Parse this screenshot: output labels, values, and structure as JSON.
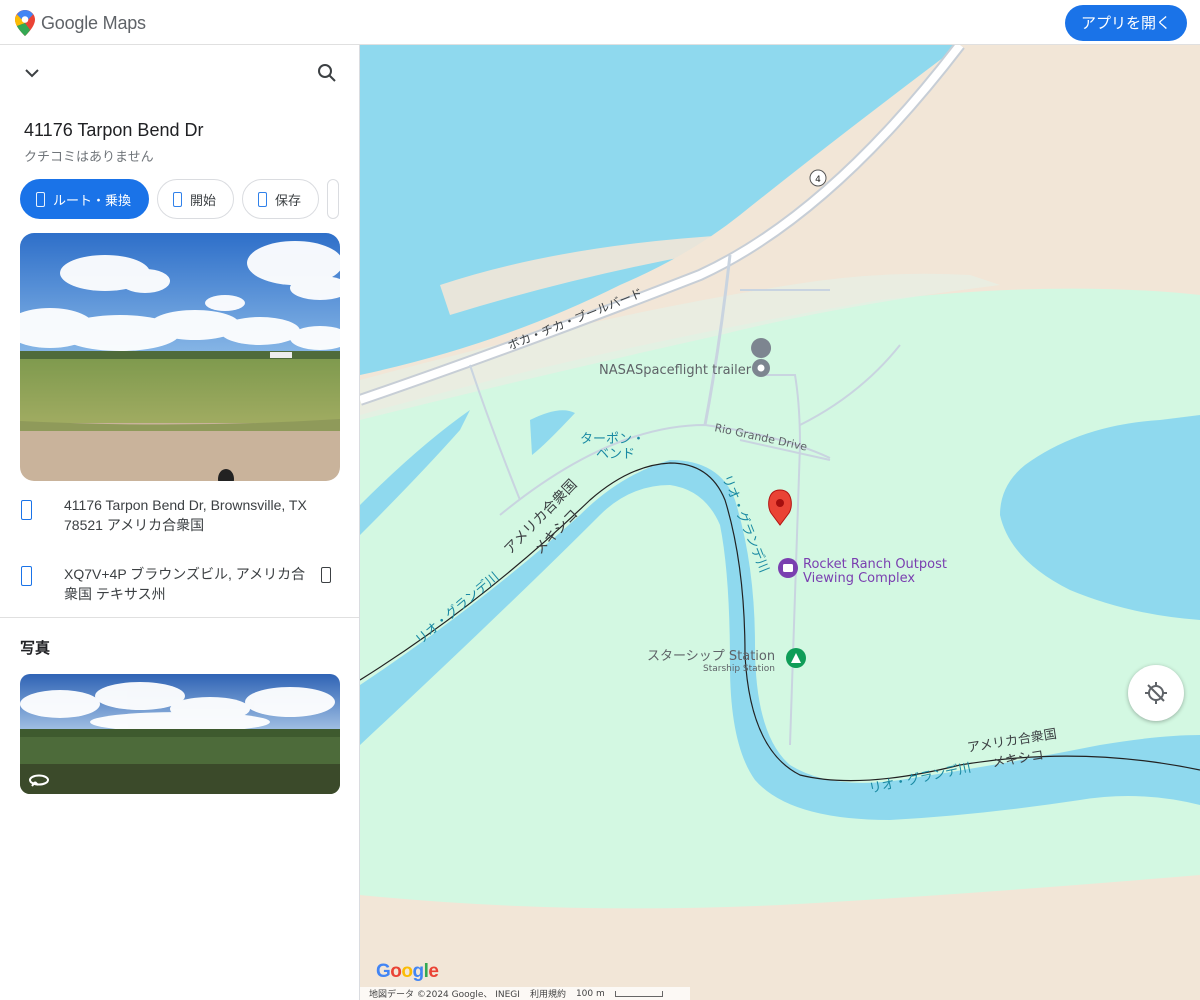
{
  "app": {
    "brand": "Google Maps",
    "open_app_label": "アプリを開く",
    "accent_color": "#1a73e8"
  },
  "panel": {
    "icons": {
      "collapse": "chevron-down-icon",
      "search": "search-icon"
    },
    "place": {
      "title": "41176 Tarpon Bend Dr",
      "subtitle": "クチコミはありません"
    },
    "actions": [
      {
        "label": "ルート・乗換",
        "icon": "directions-icon"
      },
      {
        "label": "開始",
        "icon": "navigation-icon"
      },
      {
        "label": "保存",
        "icon": "bookmark-icon"
      }
    ],
    "address": "41176 Tarpon Bend Dr, Brownsville, TX 78521 アメリカ合衆国",
    "plus_code": "XQ7V+4P ブラウンズビル, アメリカ合衆国 テキサス州",
    "photos_heading": "写真"
  },
  "map": {
    "labels": {
      "road_boca_chica": "ボカ・チカ・ブールバード",
      "road_number": "4",
      "nasa_trailer": "NASASpaceflight trailer",
      "rio_grande_drive": "Rio Grande Drive",
      "tarpon_bend_1": "ターポン・",
      "tarpon_bend_2": "ベンド",
      "usa_left": "アメリカ合衆国",
      "mexico_left": "メキシコ",
      "rio_grande_left": "リオ・グランデ川",
      "rio_grande_mid": "リオ・グランデ川",
      "rocket_ranch_1": "Rocket Ranch Outpost",
      "rocket_ranch_2": "Viewing Complex",
      "starship_jp": "スターシップ Station",
      "starship_en": "Starship Station",
      "usa_right": "アメリカ合衆国",
      "mexico_right": "メキシコ",
      "rio_grande_right": "リオ・グランデ川"
    },
    "google_logo": "Google",
    "footer": {
      "data": "地図データ ©2024 Google、 INEGI",
      "terms": "利用規約",
      "scale": "100 m"
    },
    "colors": {
      "water": "#8fd9ee",
      "green": "#d3f8e2",
      "sand": "#f2e6d7",
      "poi_purple": "#7a3fb0",
      "poi_green": "#0f9d58",
      "marker": "#ea4335"
    }
  }
}
